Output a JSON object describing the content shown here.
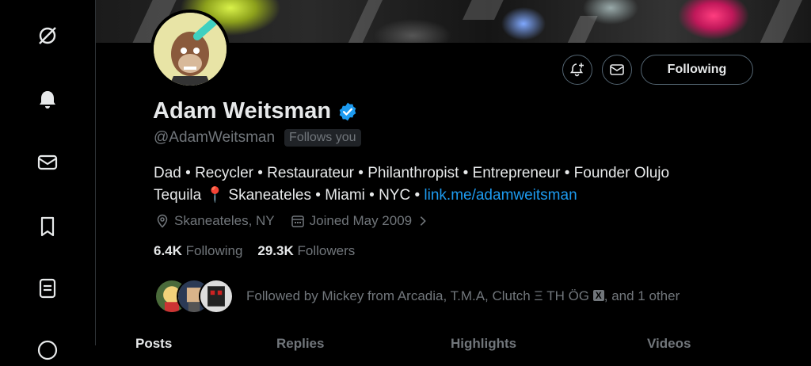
{
  "nav": {
    "icons": [
      "x-logo-icon",
      "bell-icon",
      "envelope-icon",
      "bookmark-icon",
      "list-icon",
      "more-icon"
    ]
  },
  "profile": {
    "name": "Adam Weitsman",
    "handle": "@AdamWeitsman",
    "follows_you": "Follows you",
    "verified": true,
    "bio_line1": "Dad • Recycler • Restaurateur • Philanthropist • Entrepreneur • Founder Olujo",
    "bio_line2_text": "Tequila 📍 Skaneateles • Miami • NYC • ",
    "bio_link": "link.me/adamweitsman",
    "location": "Skaneateles, NY",
    "joined": "Joined May 2009",
    "following_count": "6.4K",
    "following_label": "Following",
    "followers_count": "29.3K",
    "followers_label": "Followers",
    "followed_by_prefix": "Followed by Mickey from Arcadia, T.M.A, Clutch Ξ TH ÖG ",
    "followed_by_badge": "X",
    "followed_by_suffix": ", and 1 other"
  },
  "actions": {
    "follow_label": "Following"
  },
  "tabs": [
    "Posts",
    "Replies",
    "Highlights",
    "Videos"
  ],
  "colors": {
    "accent": "#1d9bf0",
    "muted": "#71767b",
    "text": "#e7e9ea",
    "background": "#000000"
  }
}
